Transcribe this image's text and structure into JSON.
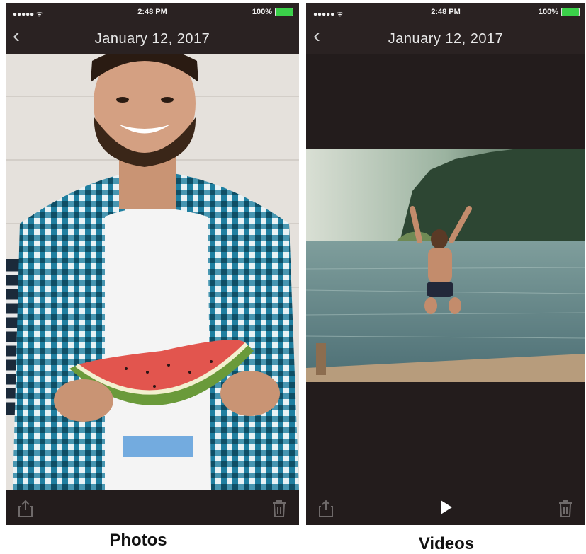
{
  "photos_screen": {
    "status": {
      "signal": "●●●●● ᯤ",
      "time": "2:48 PM",
      "battery": "100%"
    },
    "nav": {
      "title": "January 12, 2017"
    },
    "toolbar": {
      "share_icon": "share-icon",
      "trash_icon": "trash-icon"
    }
  },
  "videos_screen": {
    "status": {
      "signal": "●●●●● ᯤ",
      "time": "2:48 PM",
      "battery": "100%"
    },
    "nav": {
      "title": "January 12, 2017"
    },
    "toolbar": {
      "share_icon": "share-icon",
      "play_icon": "play-icon",
      "trash_icon": "trash-icon"
    }
  },
  "captions": {
    "left": "Photos",
    "right": "Videos"
  },
  "colors": {
    "bar_bg": "#2a2222",
    "battery": "#3bd14a",
    "photo_bg": "#e5e1dc",
    "shirt": "#1f7fa0"
  }
}
